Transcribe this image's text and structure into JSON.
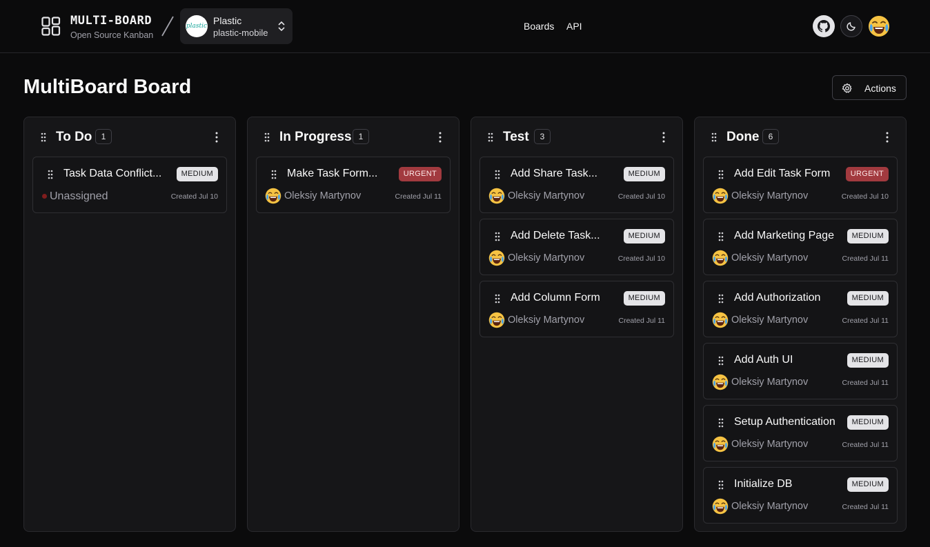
{
  "header": {
    "brand": "MULTI-BOARD",
    "tagline": "Open Source Kanban",
    "org_name": "Plastic",
    "org_logo_text": "plastic",
    "board_slug": "plastic-mobile",
    "nav": [
      "Boards",
      "API"
    ],
    "icons": [
      "github-icon",
      "moon-icon",
      "user-avatar-emoji"
    ]
  },
  "page": {
    "title": "MultiBoard Board",
    "actions_label": "Actions"
  },
  "colors": {
    "background": "#0b0b0c",
    "column": "#161618",
    "badge_medium": "#e4e4e7",
    "badge_urgent": "#a23a3f"
  },
  "columns": [
    {
      "title": "To Do",
      "count": "1",
      "cards": [
        {
          "title": "Task Data Conflict...",
          "priority": "MEDIUM",
          "assignee": "Unassigned",
          "unassigned": true,
          "created": "Created Jul 10"
        }
      ]
    },
    {
      "title": "In Progress",
      "count": "1",
      "cards": [
        {
          "title": "Make Task Form...",
          "priority": "URGENT",
          "assignee": "Oleksiy Martynov",
          "created": "Created Jul 11"
        }
      ]
    },
    {
      "title": "Test",
      "count": "3",
      "cards": [
        {
          "title": "Add Share Task...",
          "priority": "MEDIUM",
          "assignee": "Oleksiy Martynov",
          "created": "Created Jul 10"
        },
        {
          "title": "Add Delete Task...",
          "priority": "MEDIUM",
          "assignee": "Oleksiy Martynov",
          "created": "Created Jul 10"
        },
        {
          "title": "Add Column Form",
          "priority": "MEDIUM",
          "assignee": "Oleksiy Martynov",
          "created": "Created Jul 11"
        }
      ]
    },
    {
      "title": "Done",
      "count": "6",
      "cards": [
        {
          "title": "Add Edit Task Form",
          "priority": "URGENT",
          "assignee": "Oleksiy Martynov",
          "created": "Created Jul 10"
        },
        {
          "title": "Add Marketing Page",
          "priority": "MEDIUM",
          "assignee": "Oleksiy Martynov",
          "created": "Created Jul 11"
        },
        {
          "title": "Add Authorization",
          "priority": "MEDIUM",
          "assignee": "Oleksiy Martynov",
          "created": "Created Jul 11"
        },
        {
          "title": "Add Auth UI",
          "priority": "MEDIUM",
          "assignee": "Oleksiy Martynov",
          "created": "Created Jul 11"
        },
        {
          "title": "Setup Authentication",
          "priority": "MEDIUM",
          "assignee": "Oleksiy Martynov",
          "created": "Created Jul 11"
        },
        {
          "title": "Initialize DB",
          "priority": "MEDIUM",
          "assignee": "Oleksiy Martynov",
          "created": "Created Jul 11"
        }
      ]
    }
  ]
}
